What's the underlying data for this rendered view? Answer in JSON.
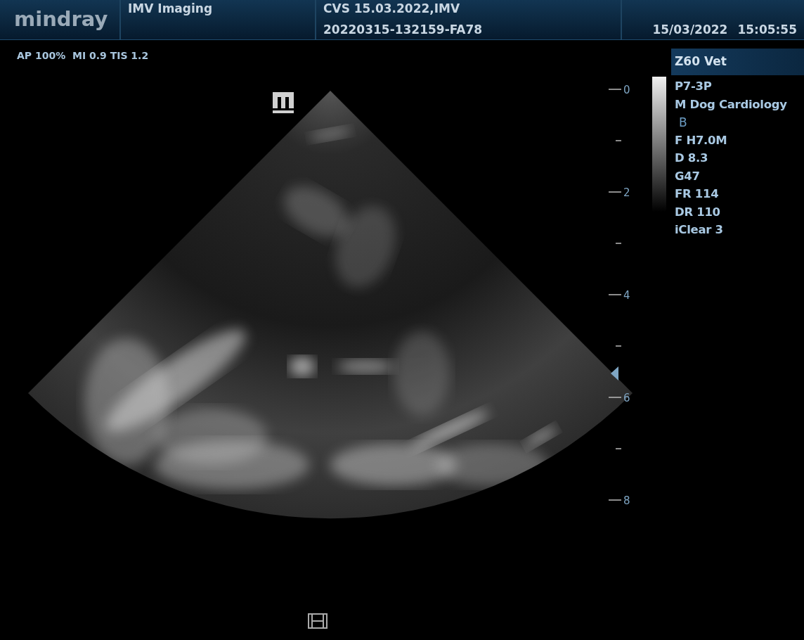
{
  "header": {
    "logo": "mindray",
    "exam_title": "IMV Imaging",
    "patient_line": "CVS 15.03.2022,IMV",
    "exam_id": "20220315-132159-FA78",
    "date": "15/03/2022",
    "time": "15:05:55"
  },
  "acoustic_output": "AP 100%  MI 0.9 TIS 1.2",
  "system": "Z60 Vet",
  "parameters": [
    {
      "text": "P7-3P",
      "kind": "value"
    },
    {
      "text": "M Dog Cardiology",
      "kind": "value"
    },
    {
      "text": "B",
      "kind": "mode"
    },
    {
      "text": "F H7.0M",
      "kind": "value"
    },
    {
      "text": "D 8.3",
      "kind": "value"
    },
    {
      "text": "G47",
      "kind": "value"
    },
    {
      "text": "FR 114",
      "kind": "value"
    },
    {
      "text": "DR 110",
      "kind": "value"
    },
    {
      "text": "iClear 3",
      "kind": "value"
    }
  ],
  "depth_scale": {
    "labels": [
      "0",
      "2",
      "4",
      "6",
      "8"
    ]
  }
}
